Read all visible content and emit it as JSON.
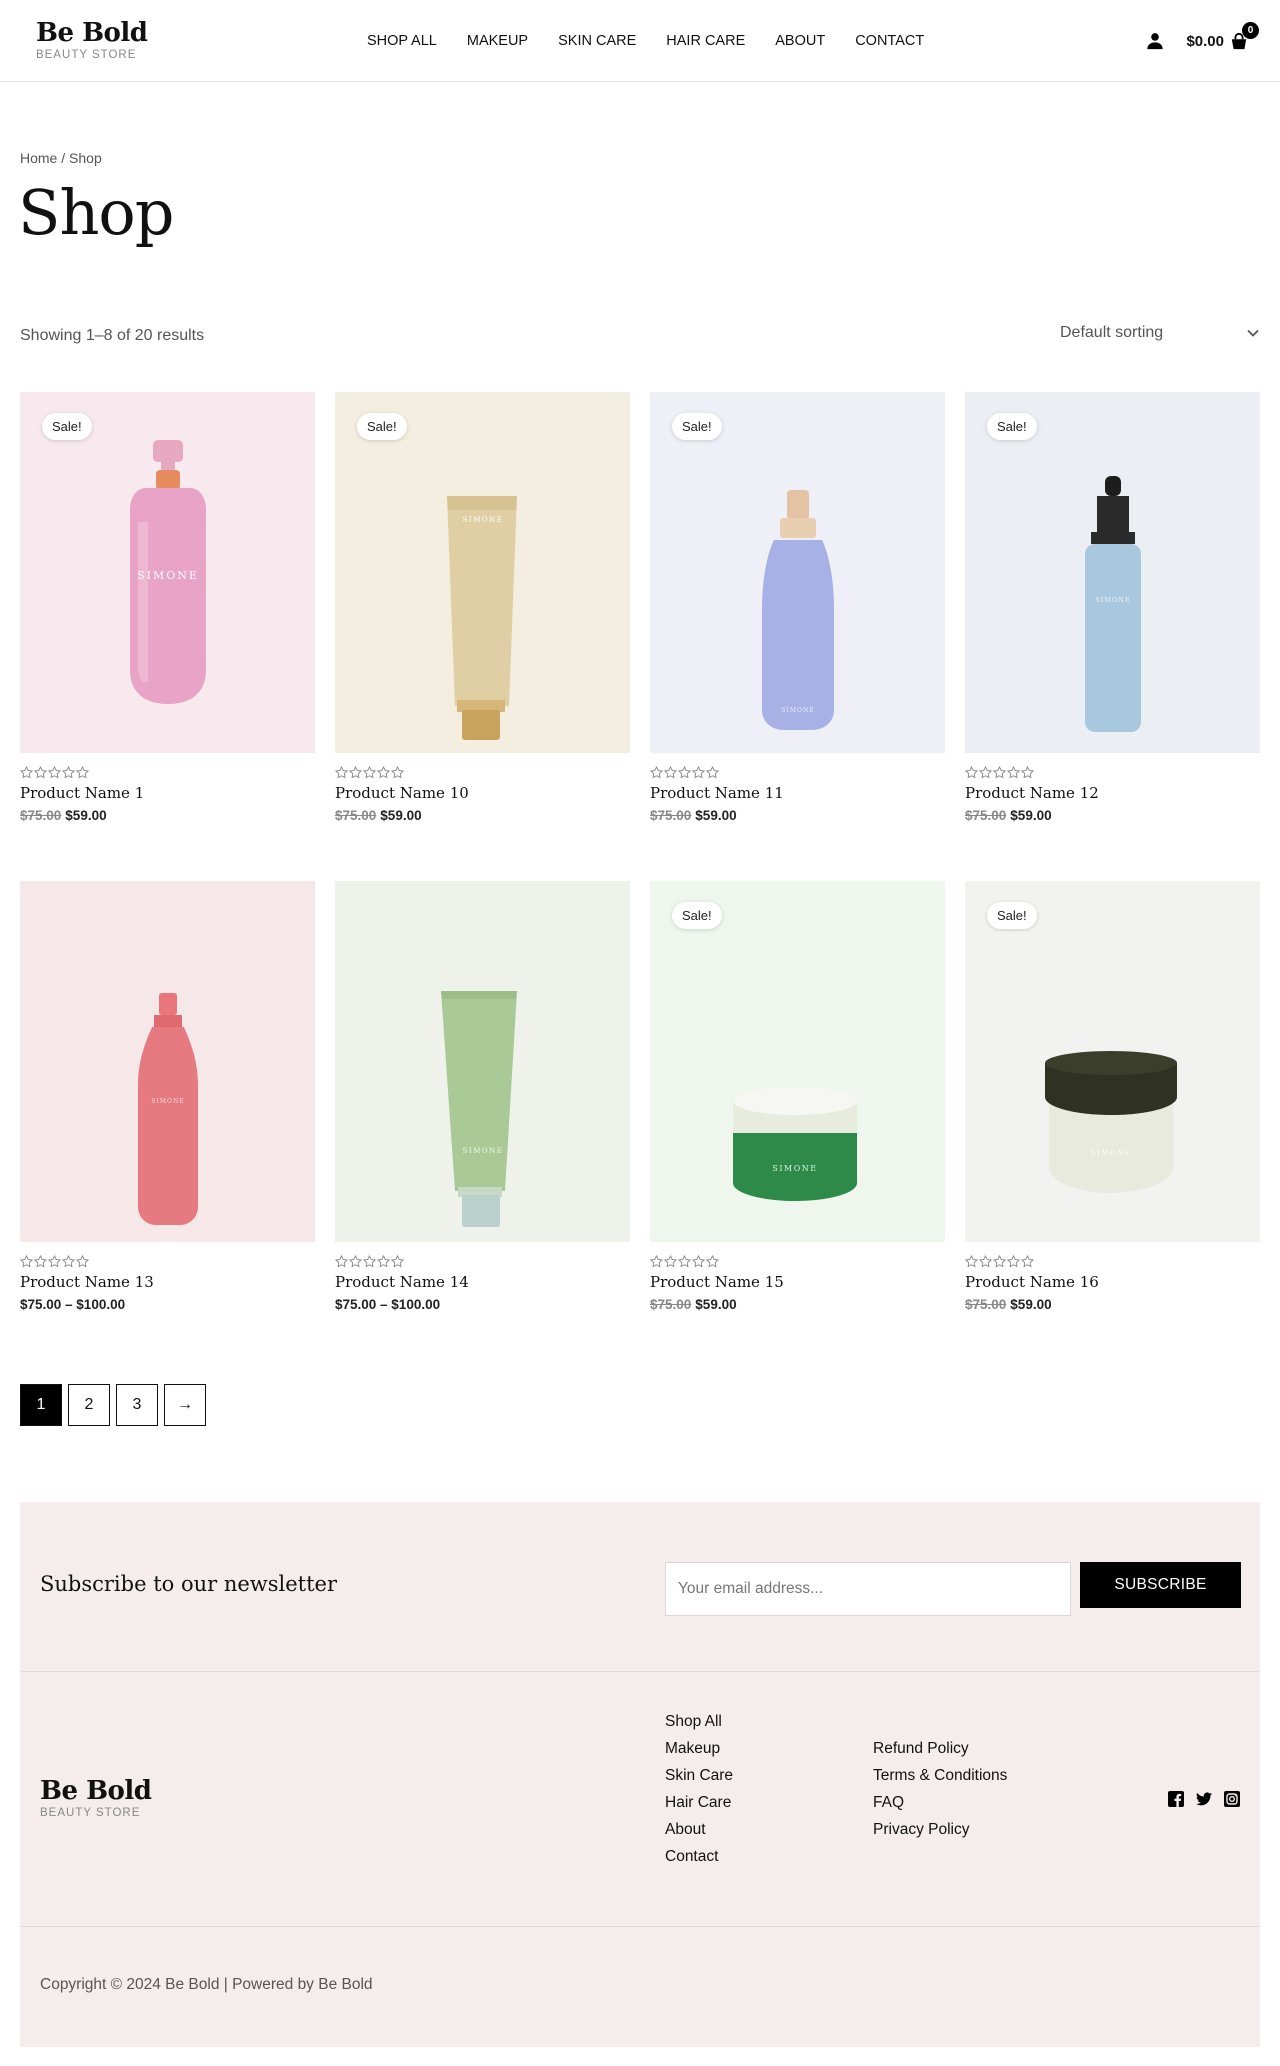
{
  "header": {
    "logo_name": "Be Bold",
    "logo_sub": "BEAUTY STORE",
    "nav": [
      "SHOP ALL",
      "MAKEUP",
      "SKIN CARE",
      "HAIR CARE",
      "ABOUT",
      "CONTACT"
    ],
    "cart_total": "$0.00",
    "cart_count": "0"
  },
  "page": {
    "breadcrumb_home": "Home",
    "breadcrumb_sep": " / ",
    "breadcrumb_current": "Shop",
    "title": "Shop",
    "result_count": "Showing 1–8 of 20 results",
    "sort_label": "Default sorting"
  },
  "products": [
    {
      "name": "Product Name 1",
      "old_price": "$75.00",
      "price": "$59.00",
      "sale": "Sale!",
      "bg": "#f7e9ee",
      "kind": "pump-pink"
    },
    {
      "name": "Product Name 10",
      "old_price": "$75.00",
      "price": "$59.00",
      "sale": "Sale!",
      "bg": "#f3eee0",
      "kind": "tube-gold"
    },
    {
      "name": "Product Name 11",
      "old_price": "$75.00",
      "price": "$59.00",
      "sale": "Sale!",
      "bg": "#eeeff7",
      "kind": "spray-blue"
    },
    {
      "name": "Product Name 12",
      "old_price": "$75.00",
      "price": "$59.00",
      "sale": "Sale!",
      "bg": "#ebeff4",
      "kind": "dropper-blue"
    },
    {
      "name": "Product Name 13",
      "old_price": "",
      "price": "$75.00 – $100.00",
      "sale": "",
      "bg": "#f6e8e8",
      "kind": "bottle-red"
    },
    {
      "name": "Product Name 14",
      "old_price": "",
      "price": "$75.00 – $100.00",
      "sale": "",
      "bg": "#eef2eb",
      "kind": "tube-green"
    },
    {
      "name": "Product Name 15",
      "old_price": "$75.00",
      "price": "$59.00",
      "sale": "Sale!",
      "bg": "#eef6ee",
      "kind": "jar-green"
    },
    {
      "name": "Product Name 16",
      "old_price": "$75.00",
      "price": "$59.00",
      "sale": "Sale!",
      "bg": "#f2f2f0",
      "kind": "jar-white"
    }
  ],
  "pagination": [
    "1",
    "2",
    "3",
    "→"
  ],
  "newsletter": {
    "title": "Subscribe to our newsletter",
    "placeholder": "Your email address...",
    "button": "SUBSCRIBE"
  },
  "footer": {
    "logo_name": "Be Bold",
    "logo_sub": "BEAUTY STORE",
    "col1": [
      "Shop All",
      "Makeup",
      "Skin Care",
      "Hair Care",
      "About",
      "Contact"
    ],
    "col2": [
      "Refund Policy",
      "Terms & Conditions",
      "FAQ",
      "Privacy Policy"
    ],
    "socials": [
      "facebook-icon",
      "twitter-icon",
      "instagram-icon"
    ],
    "copyright": "Copyright © 2024 Be Bold | Powered by Be Bold"
  }
}
